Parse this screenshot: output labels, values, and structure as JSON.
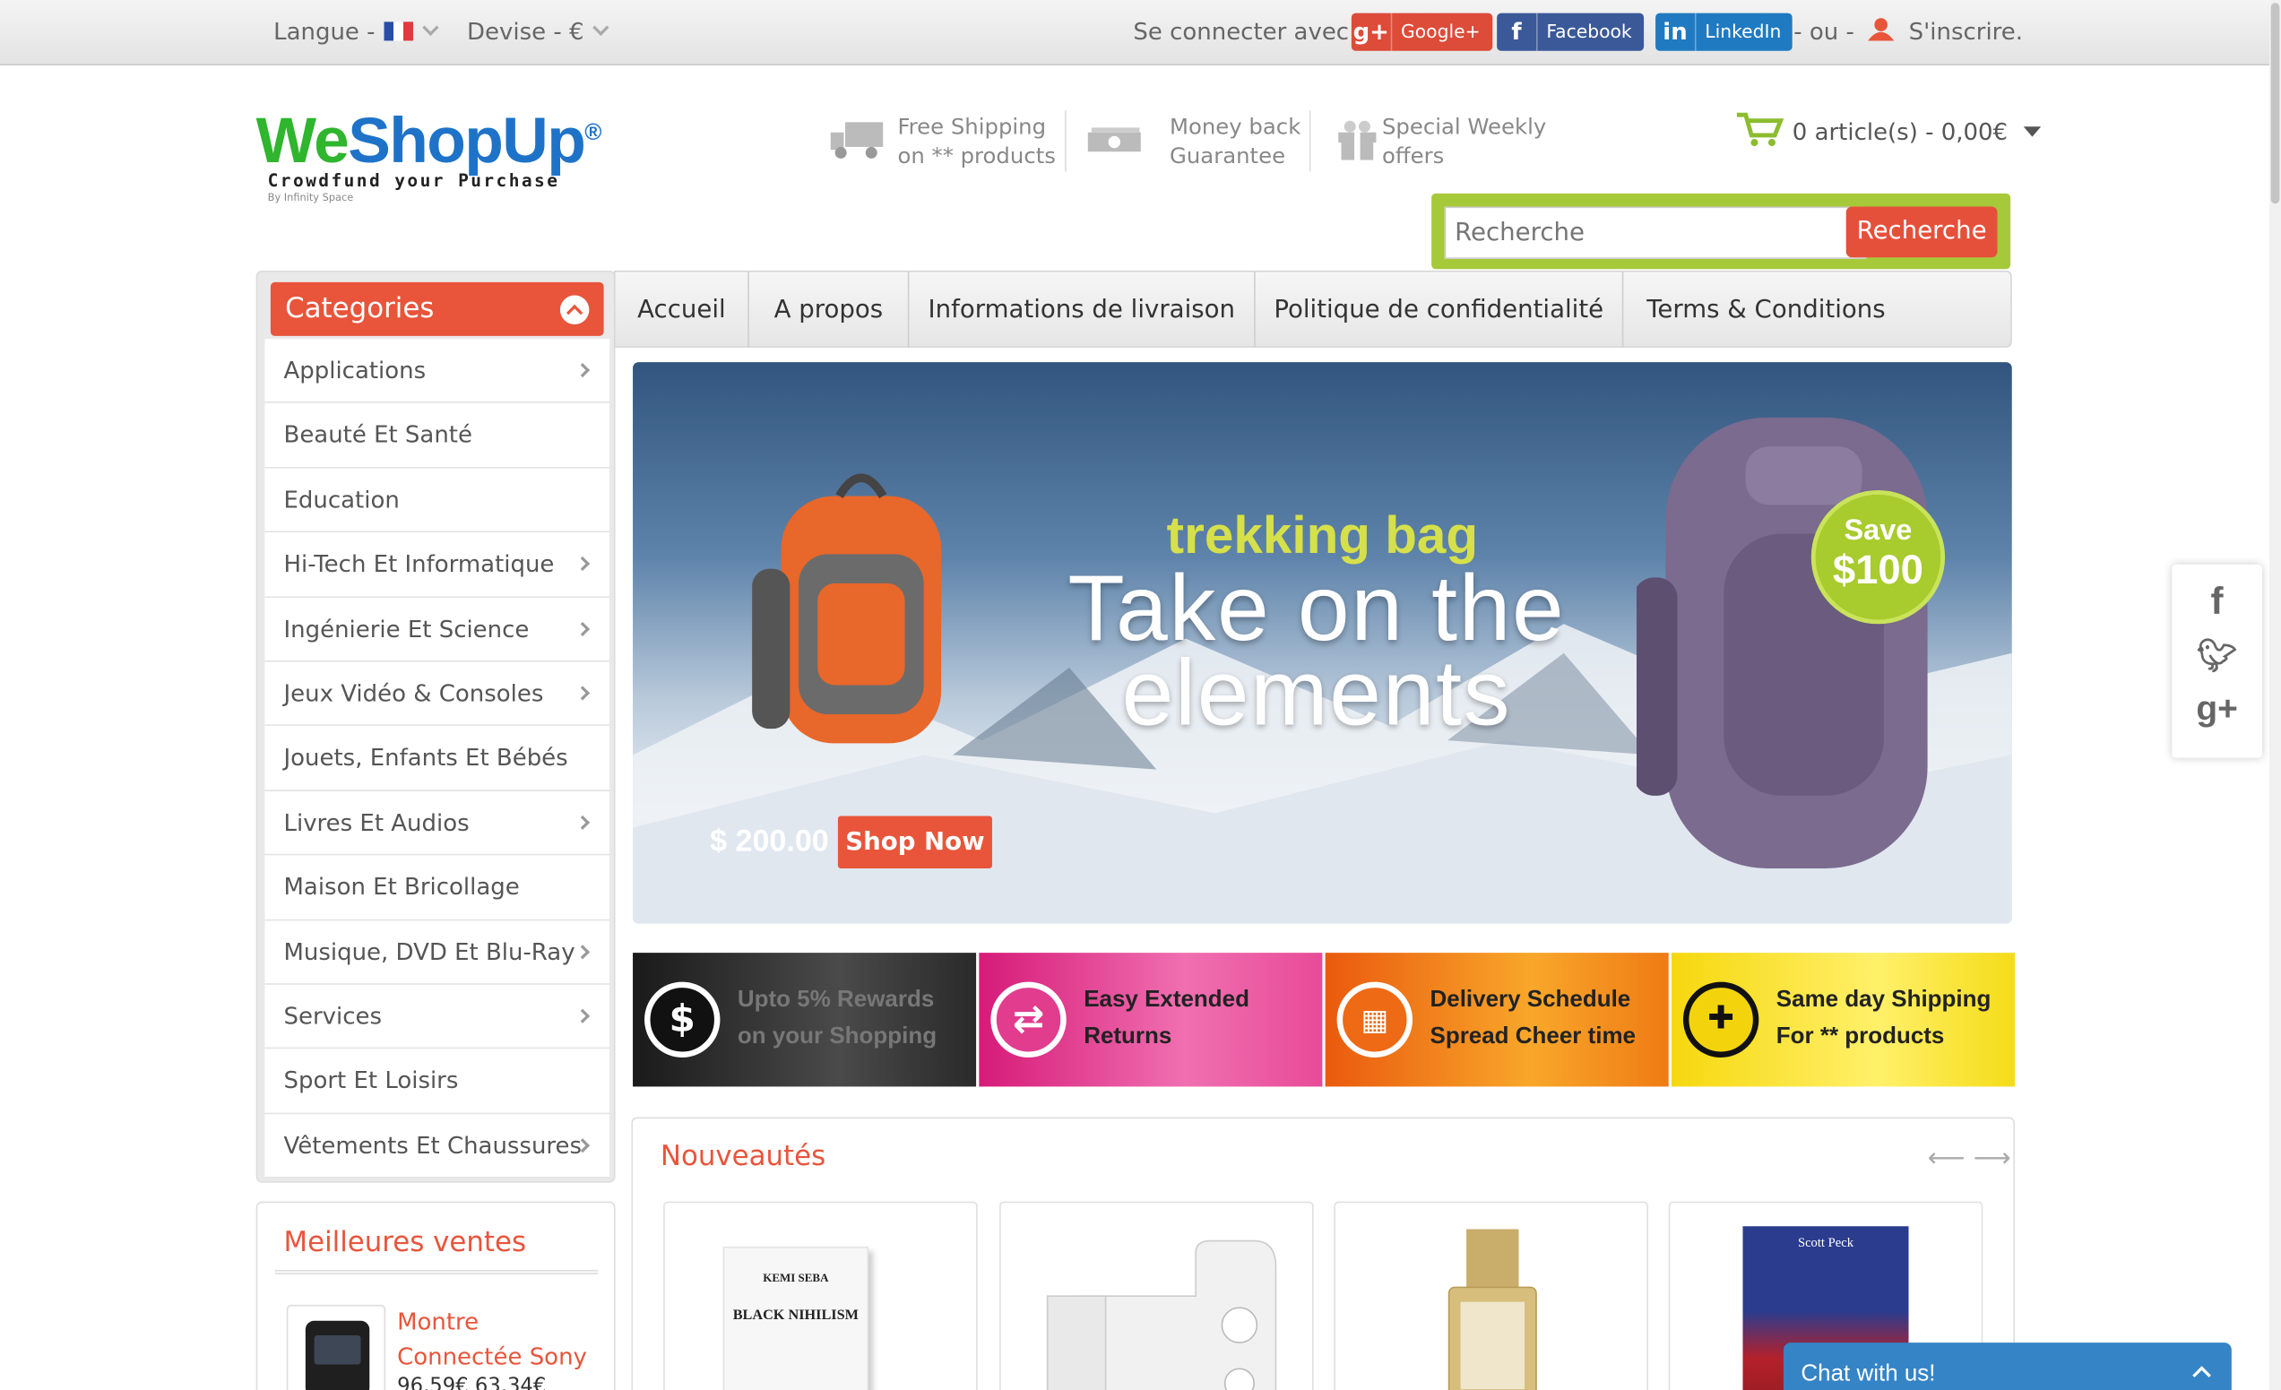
{
  "topbar": {
    "language_label": "Langue -",
    "currency_label": "Devise - €",
    "connect_label": "Se connecter avec",
    "google_label": "Google+",
    "facebook_label": "Facebook",
    "linkedin_label": "LinkedIn",
    "or_label": "- ou -",
    "signup_label": "S'inscrire."
  },
  "header": {
    "logo_we": "We",
    "logo_shop": "ShopUp",
    "logo_reg": "®",
    "tagline": "Crowdfund your Purchase",
    "byline": "By Infinity Space",
    "features": [
      {
        "line1": "Free Shipping",
        "line2": "on ** products",
        "icon": "truck-icon"
      },
      {
        "line1": "Money back",
        "line2": "Guarantee",
        "icon": "money-icon"
      },
      {
        "line1": "Special Weekly",
        "line2": "offers",
        "icon": "gift-icon"
      }
    ],
    "cart_label": "0 article(s) - 0,00€",
    "search_placeholder": "Recherche",
    "search_button": "Recherche"
  },
  "sidebar": {
    "title": "Categories",
    "items": [
      {
        "label": "Applications",
        "has_sub": true
      },
      {
        "label": "Beauté Et Santé",
        "has_sub": false
      },
      {
        "label": "Education",
        "has_sub": false
      },
      {
        "label": "Hi-Tech Et Informatique",
        "has_sub": true
      },
      {
        "label": "Ingénierie Et Science",
        "has_sub": true
      },
      {
        "label": "Jeux Vidéo & Consoles",
        "has_sub": true
      },
      {
        "label": "Jouets, Enfants Et Bébés",
        "has_sub": false
      },
      {
        "label": "Livres Et Audios",
        "has_sub": true
      },
      {
        "label": "Maison Et Bricollage",
        "has_sub": false
      },
      {
        "label": "Musique, DVD Et Blu-Ray",
        "has_sub": true
      },
      {
        "label": "Services",
        "has_sub": true
      },
      {
        "label": "Sport Et Loisirs",
        "has_sub": false
      },
      {
        "label": "Vêtements Et Chaussures",
        "has_sub": true
      }
    ],
    "bestsellers_title": "Meilleures ventes",
    "bestseller_name": "Montre Connectée Sony",
    "bestseller_price": "96,59€ 63,34€"
  },
  "nav": {
    "items": [
      "Accueil",
      "A propos",
      "Informations de livraison",
      "Politique de confidentialité",
      "Terms & Conditions"
    ]
  },
  "banner": {
    "subtitle": "trekking bag",
    "headline_1": "Take on the",
    "headline_2": "elements",
    "price": "$ 200.00",
    "cta": "Shop Now",
    "save_1": "Save",
    "save_2": "$100"
  },
  "feature_boxes": [
    {
      "line1": "Upto 5% Rewards",
      "line2": "on your Shopping",
      "icon": "dollar-icon"
    },
    {
      "line1": "Easy Extended",
      "line2": "Returns",
      "icon": "return-icon"
    },
    {
      "line1": "Delivery Schedule",
      "line2": "Spread Cheer time",
      "icon": "calendar-icon"
    },
    {
      "line1": "Same day Shipping",
      "line2": "For ** products",
      "icon": "gift-icon"
    }
  ],
  "new_products": {
    "title": "Nouveautés",
    "book_author": "KEMI SEBA",
    "book_title": "BLACK NIHILISM",
    "record_author": "Scott Peck"
  },
  "chat": {
    "label": "Chat with us!"
  },
  "colors": {
    "accent": "#e8553b",
    "green": "#a6c93a",
    "blue": "#3584c6"
  }
}
